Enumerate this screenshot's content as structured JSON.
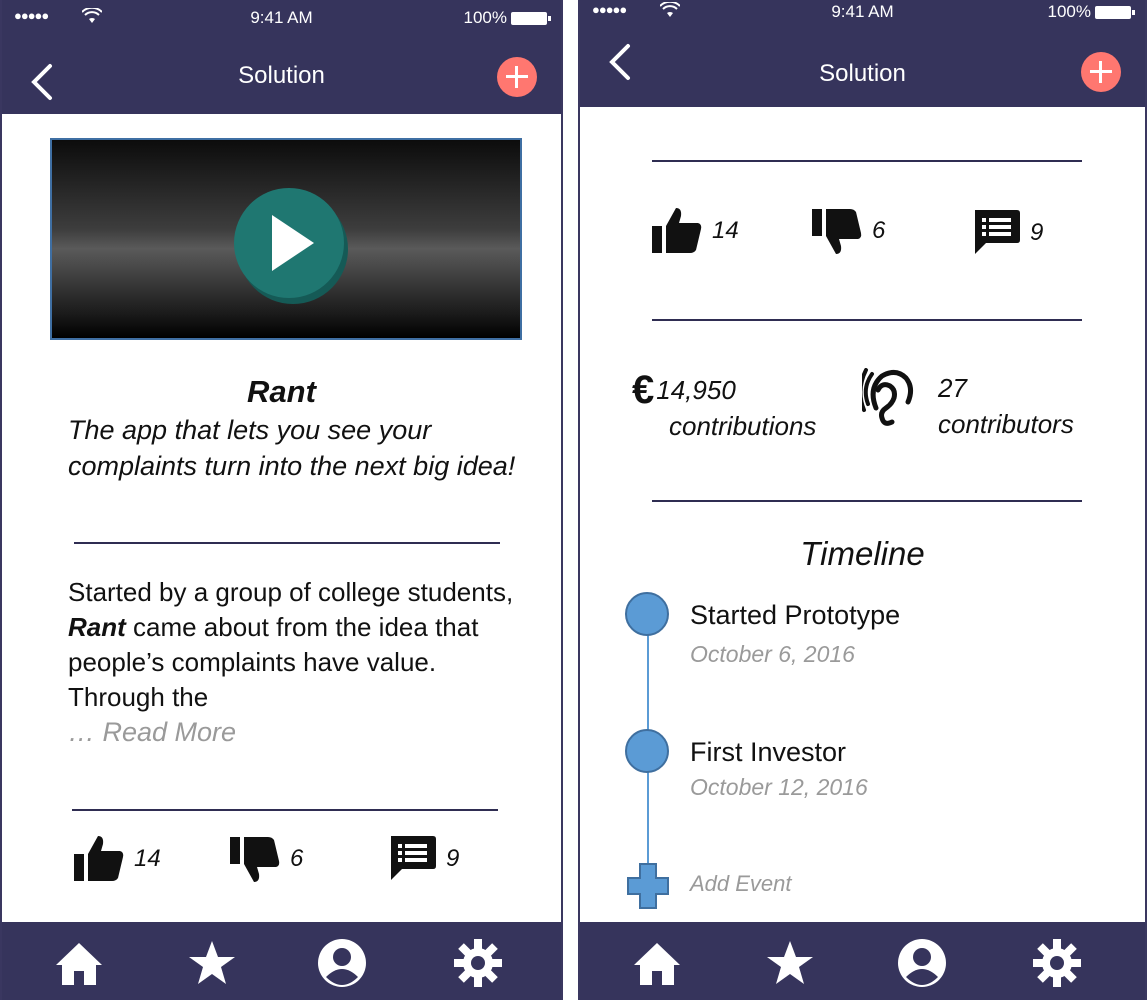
{
  "status": {
    "time": "9:41 AM",
    "battery": "100%"
  },
  "left": {
    "header_title": "Solution",
    "app_name": "Rant",
    "tagline": "The app that lets you see your complaints turn into the next big idea!",
    "desc_part1": "Started by a group of college students, ",
    "desc_bold": "Rant",
    "desc_part2": " came about from the idea that people’s complaints have value. Through the",
    "read_more": "… Read More",
    "likes": "14",
    "dislikes": "6",
    "comments": "9"
  },
  "right": {
    "header_title": "Solution",
    "likes": "14",
    "dislikes": "6",
    "comments": "9",
    "contributions_amount": "14,950",
    "contributions_label": "contributions",
    "contributors_count": "27",
    "contributors_label": "contributors",
    "timeline_title": "Timeline",
    "events": [
      {
        "title": "Started Prototype",
        "date": "October 6, 2016"
      },
      {
        "title": "First Investor",
        "date": "October 12, 2016"
      }
    ],
    "add_event": "Add Event"
  },
  "colors": {
    "header": "#36345c",
    "accent_plus": "#ff7770",
    "timeline": "#5b9bd5",
    "play": "#1f7771"
  }
}
